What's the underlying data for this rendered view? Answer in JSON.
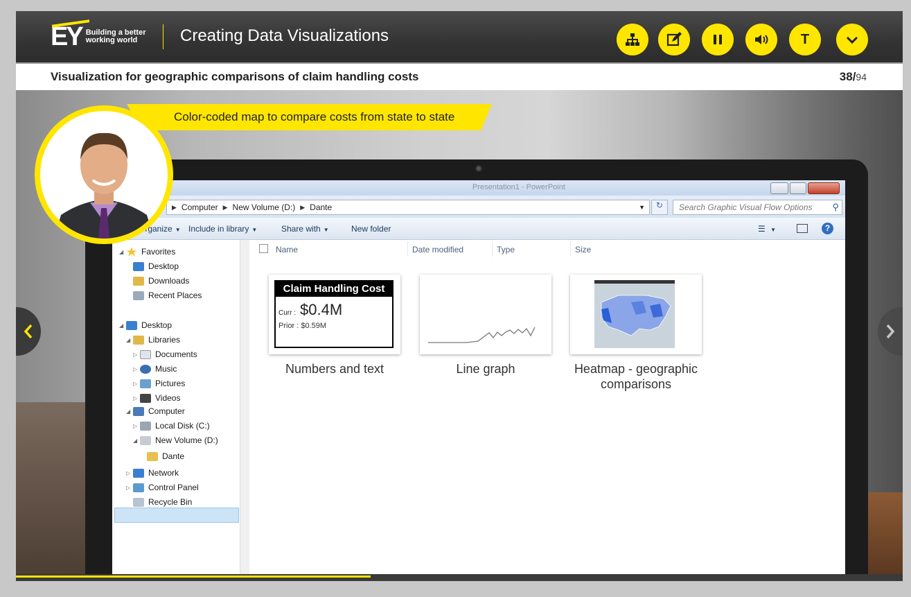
{
  "header": {
    "logo_text": "EY",
    "logo_tagline": "Building a better working world",
    "app_title": "Creating Data Visualizations",
    "buttons": [
      {
        "name": "menu",
        "icon": "sitemap-icon"
      },
      {
        "name": "notes",
        "icon": "edit-icon"
      },
      {
        "name": "pause",
        "icon": "pause-icon"
      },
      {
        "name": "volume",
        "icon": "volume-icon"
      },
      {
        "name": "transcript",
        "label": "T"
      },
      {
        "name": "expand",
        "icon": "chevron-down-icon"
      }
    ],
    "accent_color": "#ffe600"
  },
  "slide": {
    "title": "Visualization for geographic comparisons of claim handling costs",
    "page_current": "38/",
    "page_total": "94",
    "banner": "Color-coded map to compare costs from state to state",
    "progress": 0.4
  },
  "explorer": {
    "window_title": "Presentation1 - PowerPoint",
    "breadcrumb": [
      "Computer",
      "New Volume (D:)",
      "Dante"
    ],
    "search_placeholder": "Search Graphic Visual Flow Options",
    "commands": [
      "Organize",
      "Include in library",
      "Share with",
      "New folder"
    ],
    "columns": [
      "Name",
      "Date modified",
      "Type",
      "Size"
    ],
    "nav": {
      "favorites": "Favorites",
      "desktop_fav": "Desktop",
      "downloads": "Downloads",
      "recent": "Recent Places",
      "desktop": "Desktop",
      "libraries": "Libraries",
      "documents": "Documents",
      "music": "Music",
      "pictures": "Pictures",
      "videos": "Videos",
      "computer": "Computer",
      "local_disk": "Local Disk (C:)",
      "new_volume": "New Volume (D:)",
      "dante": "Dante",
      "network": "Network",
      "control_panel": "Control Panel",
      "recycle_bin": "Recycle Bin"
    },
    "files": [
      {
        "label": "Numbers and text"
      },
      {
        "label": "Line graph"
      },
      {
        "label": "Heatmap - geographic comparisons"
      }
    ],
    "card": {
      "title": "Claim Handling Cost",
      "curr_label": "Curr :",
      "curr_value": "$0.4M",
      "prior": "Prior : $0.59M"
    }
  }
}
